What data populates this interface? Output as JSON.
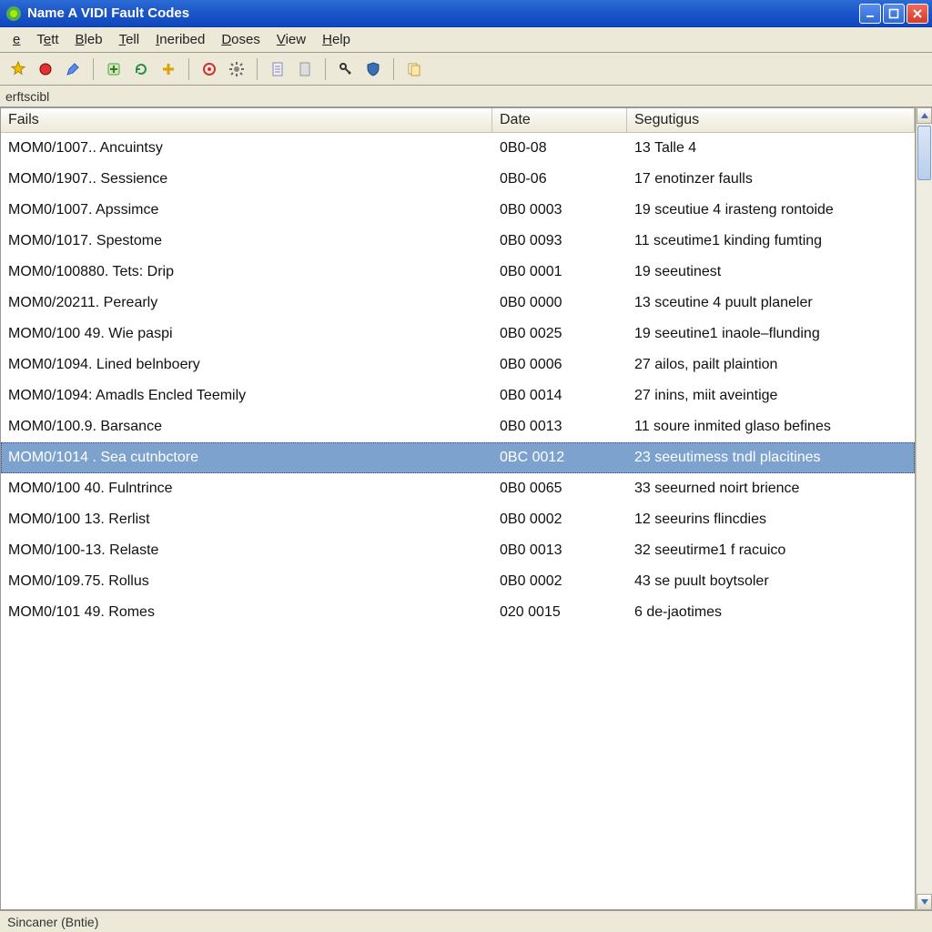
{
  "window": {
    "title": "Name A VIDI Fault Codes"
  },
  "menu": {
    "items": [
      {
        "prefix": "",
        "ul": "e",
        "suffix": ""
      },
      {
        "prefix": "T",
        "ul": "e",
        "suffix": "tt"
      },
      {
        "prefix": "",
        "ul": "B",
        "suffix": "leb"
      },
      {
        "prefix": "",
        "ul": "T",
        "suffix": "ell"
      },
      {
        "prefix": "",
        "ul": "I",
        "suffix": "neribed"
      },
      {
        "prefix": "",
        "ul": "D",
        "suffix": "oses"
      },
      {
        "prefix": "",
        "ul": "V",
        "suffix": "iew"
      },
      {
        "prefix": "",
        "ul": "H",
        "suffix": "elp"
      }
    ]
  },
  "toolbar": {
    "icons": [
      "star-icon",
      "record-icon",
      "pencil-icon",
      "sep",
      "add-icon",
      "refresh-icon",
      "plus-icon",
      "sep",
      "target-icon",
      "gear-icon",
      "sep",
      "doc-icon",
      "page-icon",
      "sep",
      "key-icon",
      "shield-icon",
      "sep",
      "copy-icon"
    ]
  },
  "pathbar": {
    "text": "erftscibl"
  },
  "columns": {
    "fail": "Fails",
    "date": "Date",
    "seg": "Segutigus"
  },
  "rows": [
    {
      "fail": "MOM0/1007.. Ancuintsy",
      "date": "0B0-08",
      "seg": "13 Talle 4",
      "selected": false
    },
    {
      "fail": "MOM0/1907.. Sessience",
      "date": "0B0-06",
      "seg": "17 enotinzer faulls",
      "selected": false
    },
    {
      "fail": "MOM0/1007. Apssimce",
      "date": "0B0 0003",
      "seg": "19 sceutiue 4 irasteng rontoide",
      "selected": false
    },
    {
      "fail": "MOM0/1017. Spestome",
      "date": "0B0 0093",
      "seg": "11 sceutime1 kinding fumting",
      "selected": false
    },
    {
      "fail": "MOM0/100880. Tets: Drip",
      "date": "0B0 0001",
      "seg": "19 seeutinest",
      "selected": false
    },
    {
      "fail": "MOM0/20211. Perearly",
      "date": "0B0 0000",
      "seg": "13 sceutine 4 puult planeler",
      "selected": false
    },
    {
      "fail": "MOM0/100 49. Wie paspi",
      "date": "0B0 0025",
      "seg": "19 seeutine1 inaole–flunding",
      "selected": false
    },
    {
      "fail": "MOM0/1094. Lined belnboery",
      "date": "0B0 0006",
      "seg": "27 ailos, pailt plaintion",
      "selected": false
    },
    {
      "fail": "MOM0/1094: Amadls Encled Teemily",
      "date": "0B0 0014",
      "seg": "27 inins, miit aveintige",
      "selected": false
    },
    {
      "fail": "MOM0/100.9. Barsance",
      "date": "0B0 0013",
      "seg": "11 soure inmited glaso befines",
      "selected": false
    },
    {
      "fail": "MOM0/1014 . Sea cutnbctore",
      "date": "0BC 0012",
      "seg": "23 seeutimess tndl placitines",
      "selected": true
    },
    {
      "fail": "MOM0/100 40. Fulntrince",
      "date": "0B0 0065",
      "seg": "33 seeurned noirt brience",
      "selected": false
    },
    {
      "fail": "MOM0/100 13. Rerlist",
      "date": "0B0 0002",
      "seg": "12 seeurins flincdies",
      "selected": false
    },
    {
      "fail": "MOM0/100-13. Relaste",
      "date": "0B0 0013",
      "seg": "32 seeutirme1 f racuico",
      "selected": false
    },
    {
      "fail": "MOM0/109.75. Rollus",
      "date": "0B0 0002",
      "seg": "43 se puult boytsoler",
      "selected": false
    },
    {
      "fail": "MOM0/101 49. Romes",
      "date": "020 0015",
      "seg": " 6 de-jaotimes",
      "selected": false
    }
  ],
  "status": {
    "text": "Sincaner (Bntie)"
  }
}
